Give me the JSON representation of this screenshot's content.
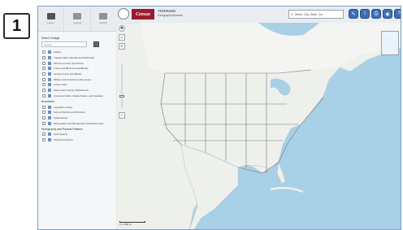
{
  "step_badge": "1",
  "sidebar": {
    "tabs": [
      {
        "label": "Layers",
        "active": true
      },
      {
        "label": "Legend",
        "active": false
      },
      {
        "label": "Identify",
        "active": false
      }
    ],
    "select_label": "Select Vintage",
    "select_value": "Current",
    "groups": [
      {
        "label": "",
        "items": [
          {
            "label": "Labels",
            "color": "#6c8ebf"
          },
          {
            "label": "Transportation (Roads and Railroads)",
            "color": "#6c8ebf"
          },
          {
            "label": "ZIP Area Codes and ZCTAs",
            "color": "#6c8ebf"
          },
          {
            "label": "Tracts and Block Groups/Blocks",
            "color": "#6c8ebf"
          },
          {
            "label": "Census Tracts and Blocks",
            "color": "#6c8ebf"
          },
          {
            "label": "Military and American Indian Areas",
            "color": "#6c8ebf"
          },
          {
            "label": "Urban Areas",
            "color": "#6c8ebf"
          },
          {
            "label": "Places and County Subdivisions",
            "color": "#6c8ebf"
          },
          {
            "label": "American Indian, Alaska Native, and Hawaiian",
            "color": "#6c8ebf"
          }
        ]
      },
      {
        "label": "Boundaries",
        "items": [
          {
            "label": "Legislative Areas",
            "color": "#6c8ebf"
          },
          {
            "label": "School Districts and Divisions",
            "color": "#6c8ebf"
          },
          {
            "label": "States/Areas",
            "color": "#6c8ebf"
          },
          {
            "label": "Metropolitan and Micropolitan Statistical Areas",
            "color": "#6c8ebf"
          }
        ]
      },
      {
        "label": "Hydrography and Physical Features",
        "items": [
          {
            "label": "Hydrography",
            "color": "#6c8ebf"
          },
          {
            "label": "Physical Features",
            "color": "#6c8ebf"
          }
        ]
      }
    ]
  },
  "header": {
    "logo_text": "Census",
    "title": "TIGERweb",
    "subtitle": "Geography Browser",
    "search_placeholder": "Street, City, State, Zip"
  },
  "toolbar": {
    "buttons": [
      {
        "name": "draw-button",
        "icon": "✎"
      },
      {
        "name": "info-button",
        "icon": "i"
      },
      {
        "name": "print-button",
        "icon": "⎙"
      },
      {
        "name": "globe-button",
        "icon": "◉"
      },
      {
        "name": "help-button",
        "icon": "?"
      }
    ]
  },
  "map": {
    "scale_label": "0 - 1,000 mi",
    "nav": {
      "home_icon": "⌂",
      "zoom_in": "+",
      "zoom_out": "−"
    }
  }
}
